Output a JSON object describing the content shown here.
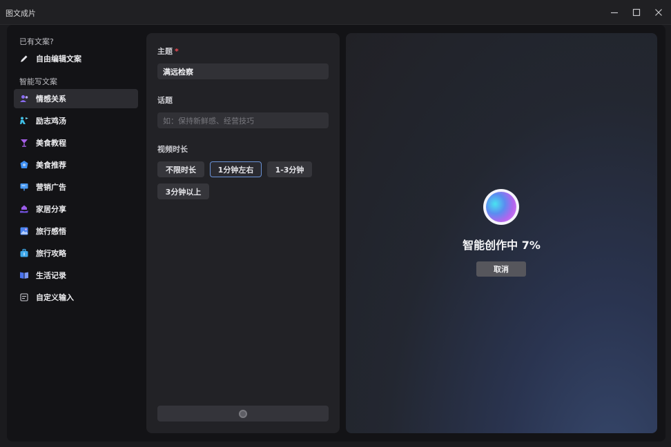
{
  "window": {
    "title": "图文成片",
    "controls": [
      "minimize-icon",
      "maximize-icon",
      "close-icon"
    ]
  },
  "sidebar": {
    "existing_section": "已有文案?",
    "free_edit": {
      "label": "自由编辑文案",
      "icon": "pencil-icon"
    },
    "smart_section": "智能写文案",
    "items": [
      {
        "label": "情感关系",
        "icon": "people-icon",
        "color": "#8a6cf2",
        "active": true
      },
      {
        "label": "励志鸡汤",
        "icon": "person-flag-icon",
        "color": "#3fbfe6"
      },
      {
        "label": "美食教程",
        "icon": "cocktail-glass-icon",
        "color": "#a65fe8"
      },
      {
        "label": "美食推荐",
        "icon": "food-badge-icon",
        "color": "#3d8ef2"
      },
      {
        "label": "营销广告",
        "icon": "billboard-icon",
        "color": "#4a9af2"
      },
      {
        "label": "家居分享",
        "icon": "home-hand-icon",
        "color": "#9a5ce8"
      },
      {
        "label": "旅行感悟",
        "icon": "photo-landscape-icon",
        "color": "#4a85f0"
      },
      {
        "label": "旅行攻略",
        "icon": "suitcase-icon",
        "color": "#3fa8ea"
      },
      {
        "label": "生活记录",
        "icon": "open-book-icon",
        "color": "#4a72ee"
      },
      {
        "label": "自定义输入",
        "icon": "edit-lines-icon",
        "color": "#c8c8d0"
      }
    ]
  },
  "form": {
    "topic": {
      "label": "主题",
      "required_mark": "*",
      "value": "满远检察"
    },
    "subject": {
      "label": "话题",
      "placeholder": "如：保持新鲜感、经营技巧"
    },
    "duration": {
      "label": "视频时长",
      "options": [
        "不限时长",
        "1分钟左右",
        "1-3分钟",
        "3分钟以上"
      ],
      "selected": "1分钟左右"
    }
  },
  "preview": {
    "status_text": "智能创作中 7%",
    "progress_percent": 7,
    "cancel_label": "取消"
  },
  "colors": {
    "accent_border": "#6a93d8",
    "required": "#ef4a54"
  }
}
